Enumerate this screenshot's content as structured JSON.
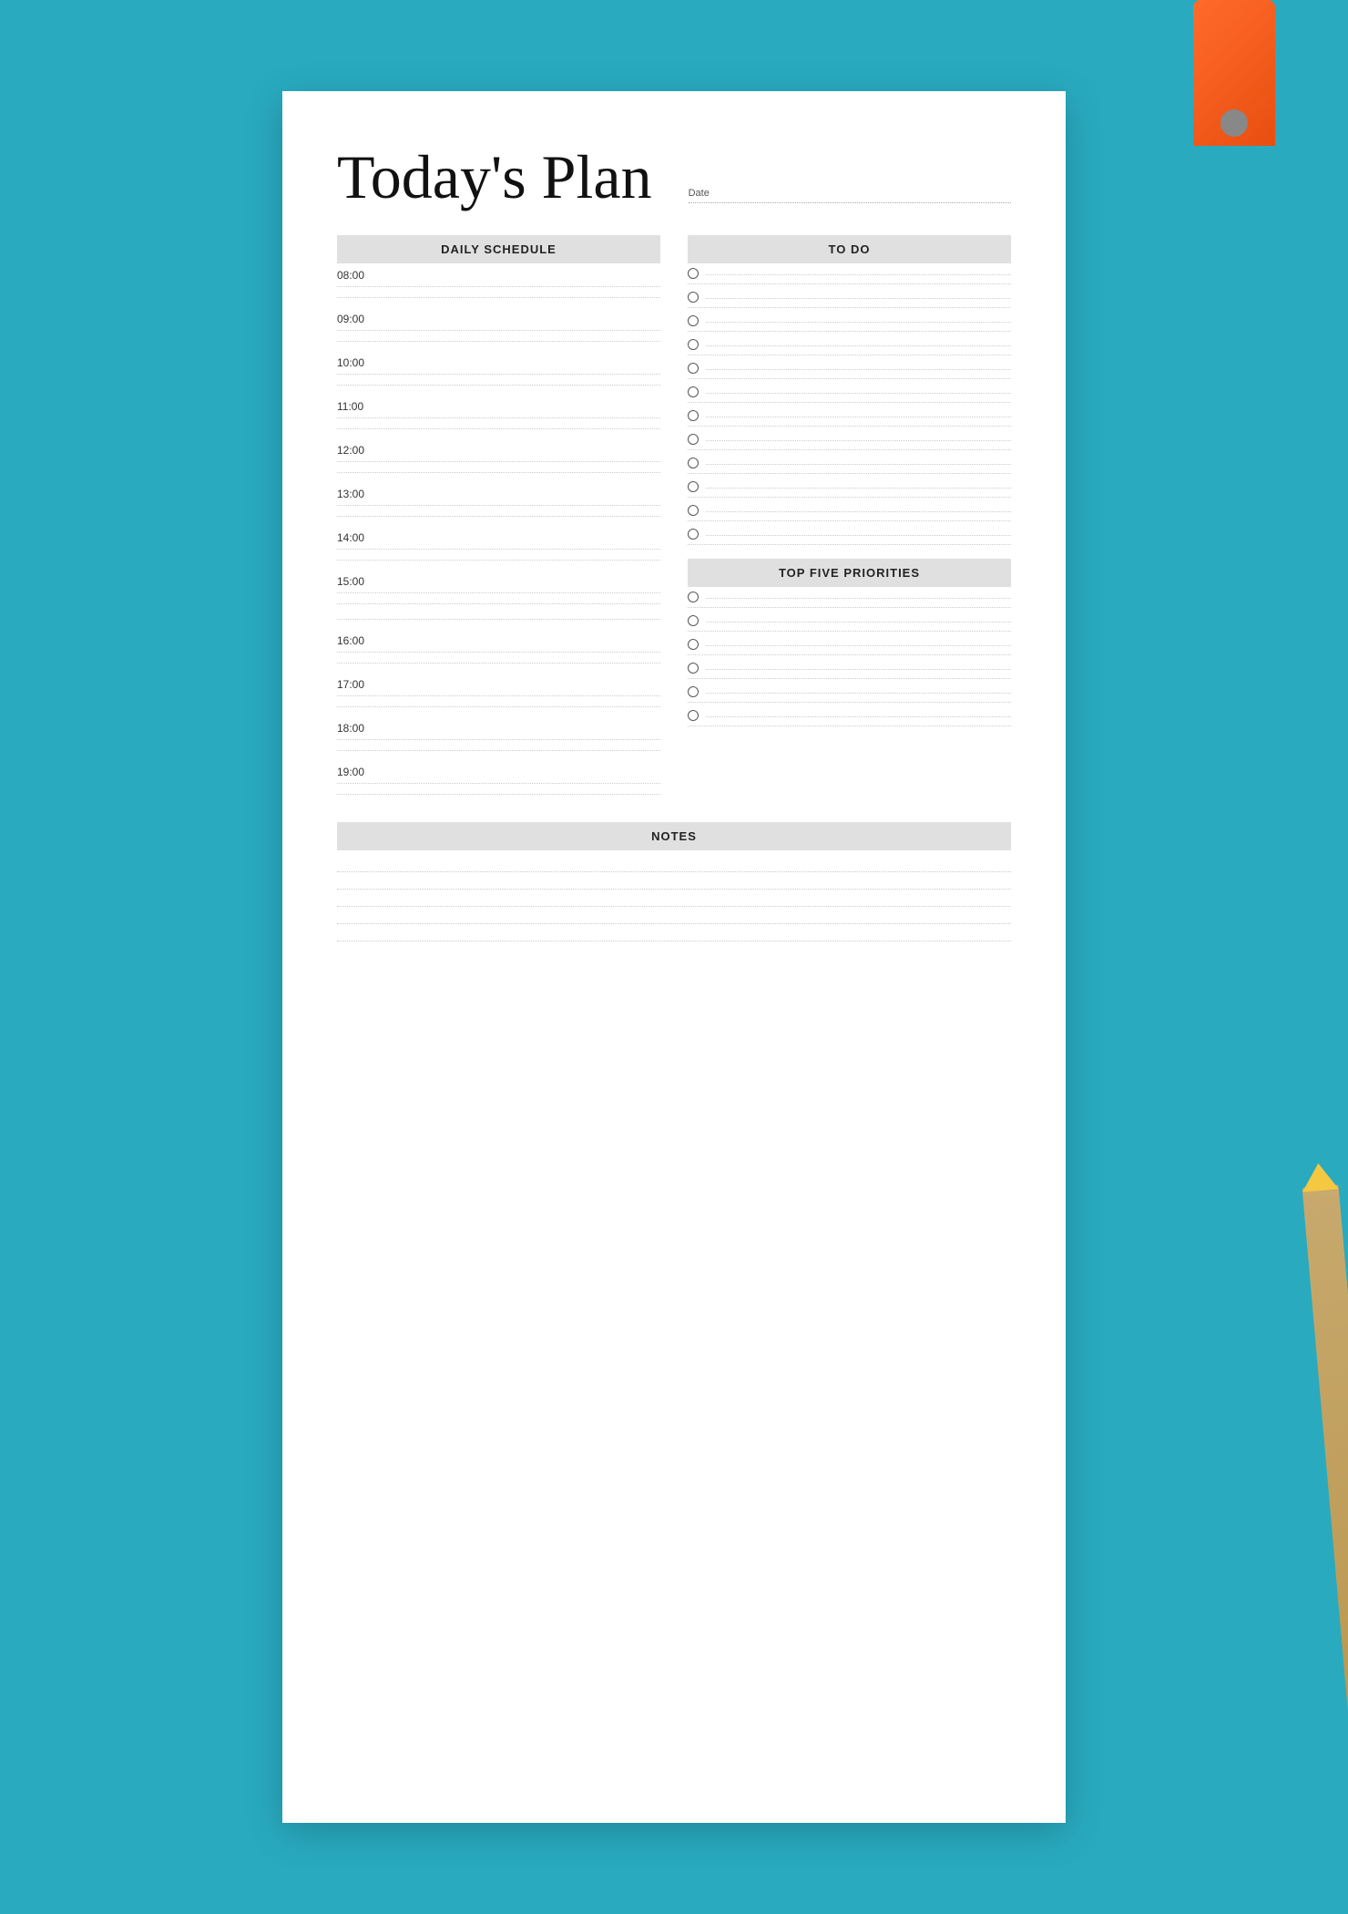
{
  "page": {
    "title": "Today's Plan",
    "date_label": "Date",
    "background_color": "#29aabf"
  },
  "schedule": {
    "header": "DAILY SCHEDULE",
    "times": [
      "08:00",
      "09:00",
      "10:00",
      "11:00",
      "12:00",
      "13:00",
      "14:00",
      "15:00",
      "16:00",
      "17:00",
      "18:00",
      "19:00"
    ]
  },
  "todo": {
    "header": "TO DO",
    "items": 12
  },
  "priorities": {
    "header": "TOP FIVE PRIORITIES",
    "items": 6
  },
  "notes": {
    "header": "NOTES",
    "lines": 5
  }
}
